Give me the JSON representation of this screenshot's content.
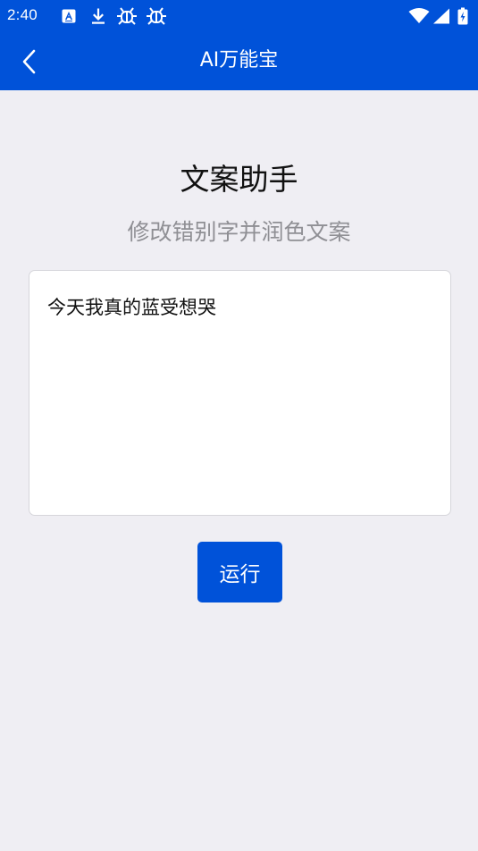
{
  "status_bar": {
    "time": "2:40",
    "icons": [
      "app-notification-icon",
      "download-icon",
      "bug-icon",
      "bug-icon",
      "wifi-icon",
      "signal-icon",
      "battery-charging-icon"
    ]
  },
  "app_bar": {
    "back_icon": "chevron-left-icon",
    "title": "AI万能宝"
  },
  "main": {
    "heading": "文案助手",
    "subheading": "修改错别字并润色文案",
    "input_text": "今天我真的蓝受想哭",
    "run_button_label": "运行"
  },
  "colors": {
    "primary": "#0052d9",
    "background": "#efeef3",
    "subtext": "#8f8f94"
  }
}
